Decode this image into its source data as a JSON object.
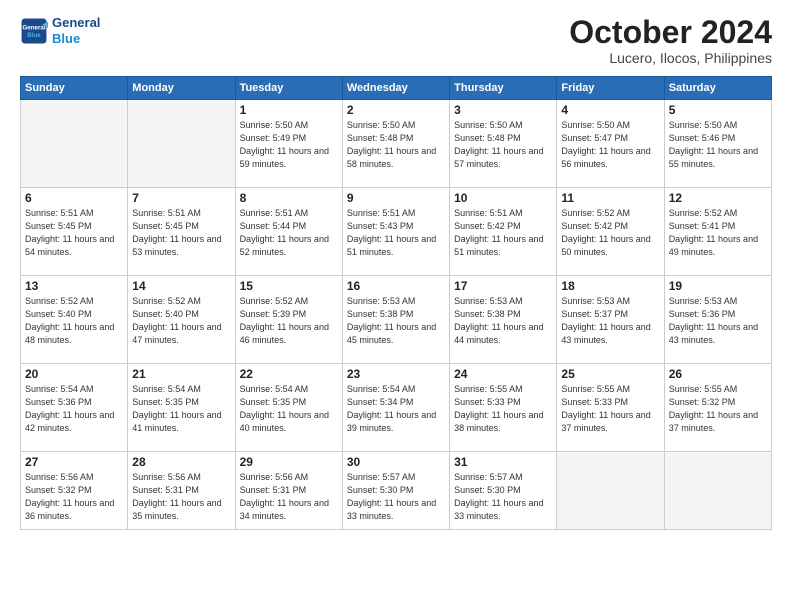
{
  "header": {
    "logo_line1": "General",
    "logo_line2": "Blue",
    "month": "October 2024",
    "location": "Lucero, Ilocos, Philippines"
  },
  "days_of_week": [
    "Sunday",
    "Monday",
    "Tuesday",
    "Wednesday",
    "Thursday",
    "Friday",
    "Saturday"
  ],
  "weeks": [
    [
      {
        "day": "",
        "info": ""
      },
      {
        "day": "",
        "info": ""
      },
      {
        "day": "1",
        "info": "Sunrise: 5:50 AM\nSunset: 5:49 PM\nDaylight: 11 hours and 59 minutes."
      },
      {
        "day": "2",
        "info": "Sunrise: 5:50 AM\nSunset: 5:48 PM\nDaylight: 11 hours and 58 minutes."
      },
      {
        "day": "3",
        "info": "Sunrise: 5:50 AM\nSunset: 5:48 PM\nDaylight: 11 hours and 57 minutes."
      },
      {
        "day": "4",
        "info": "Sunrise: 5:50 AM\nSunset: 5:47 PM\nDaylight: 11 hours and 56 minutes."
      },
      {
        "day": "5",
        "info": "Sunrise: 5:50 AM\nSunset: 5:46 PM\nDaylight: 11 hours and 55 minutes."
      }
    ],
    [
      {
        "day": "6",
        "info": "Sunrise: 5:51 AM\nSunset: 5:45 PM\nDaylight: 11 hours and 54 minutes."
      },
      {
        "day": "7",
        "info": "Sunrise: 5:51 AM\nSunset: 5:45 PM\nDaylight: 11 hours and 53 minutes."
      },
      {
        "day": "8",
        "info": "Sunrise: 5:51 AM\nSunset: 5:44 PM\nDaylight: 11 hours and 52 minutes."
      },
      {
        "day": "9",
        "info": "Sunrise: 5:51 AM\nSunset: 5:43 PM\nDaylight: 11 hours and 51 minutes."
      },
      {
        "day": "10",
        "info": "Sunrise: 5:51 AM\nSunset: 5:42 PM\nDaylight: 11 hours and 51 minutes."
      },
      {
        "day": "11",
        "info": "Sunrise: 5:52 AM\nSunset: 5:42 PM\nDaylight: 11 hours and 50 minutes."
      },
      {
        "day": "12",
        "info": "Sunrise: 5:52 AM\nSunset: 5:41 PM\nDaylight: 11 hours and 49 minutes."
      }
    ],
    [
      {
        "day": "13",
        "info": "Sunrise: 5:52 AM\nSunset: 5:40 PM\nDaylight: 11 hours and 48 minutes."
      },
      {
        "day": "14",
        "info": "Sunrise: 5:52 AM\nSunset: 5:40 PM\nDaylight: 11 hours and 47 minutes."
      },
      {
        "day": "15",
        "info": "Sunrise: 5:52 AM\nSunset: 5:39 PM\nDaylight: 11 hours and 46 minutes."
      },
      {
        "day": "16",
        "info": "Sunrise: 5:53 AM\nSunset: 5:38 PM\nDaylight: 11 hours and 45 minutes."
      },
      {
        "day": "17",
        "info": "Sunrise: 5:53 AM\nSunset: 5:38 PM\nDaylight: 11 hours and 44 minutes."
      },
      {
        "day": "18",
        "info": "Sunrise: 5:53 AM\nSunset: 5:37 PM\nDaylight: 11 hours and 43 minutes."
      },
      {
        "day": "19",
        "info": "Sunrise: 5:53 AM\nSunset: 5:36 PM\nDaylight: 11 hours and 43 minutes."
      }
    ],
    [
      {
        "day": "20",
        "info": "Sunrise: 5:54 AM\nSunset: 5:36 PM\nDaylight: 11 hours and 42 minutes."
      },
      {
        "day": "21",
        "info": "Sunrise: 5:54 AM\nSunset: 5:35 PM\nDaylight: 11 hours and 41 minutes."
      },
      {
        "day": "22",
        "info": "Sunrise: 5:54 AM\nSunset: 5:35 PM\nDaylight: 11 hours and 40 minutes."
      },
      {
        "day": "23",
        "info": "Sunrise: 5:54 AM\nSunset: 5:34 PM\nDaylight: 11 hours and 39 minutes."
      },
      {
        "day": "24",
        "info": "Sunrise: 5:55 AM\nSunset: 5:33 PM\nDaylight: 11 hours and 38 minutes."
      },
      {
        "day": "25",
        "info": "Sunrise: 5:55 AM\nSunset: 5:33 PM\nDaylight: 11 hours and 37 minutes."
      },
      {
        "day": "26",
        "info": "Sunrise: 5:55 AM\nSunset: 5:32 PM\nDaylight: 11 hours and 37 minutes."
      }
    ],
    [
      {
        "day": "27",
        "info": "Sunrise: 5:56 AM\nSunset: 5:32 PM\nDaylight: 11 hours and 36 minutes."
      },
      {
        "day": "28",
        "info": "Sunrise: 5:56 AM\nSunset: 5:31 PM\nDaylight: 11 hours and 35 minutes."
      },
      {
        "day": "29",
        "info": "Sunrise: 5:56 AM\nSunset: 5:31 PM\nDaylight: 11 hours and 34 minutes."
      },
      {
        "day": "30",
        "info": "Sunrise: 5:57 AM\nSunset: 5:30 PM\nDaylight: 11 hours and 33 minutes."
      },
      {
        "day": "31",
        "info": "Sunrise: 5:57 AM\nSunset: 5:30 PM\nDaylight: 11 hours and 33 minutes."
      },
      {
        "day": "",
        "info": ""
      },
      {
        "day": "",
        "info": ""
      }
    ]
  ]
}
